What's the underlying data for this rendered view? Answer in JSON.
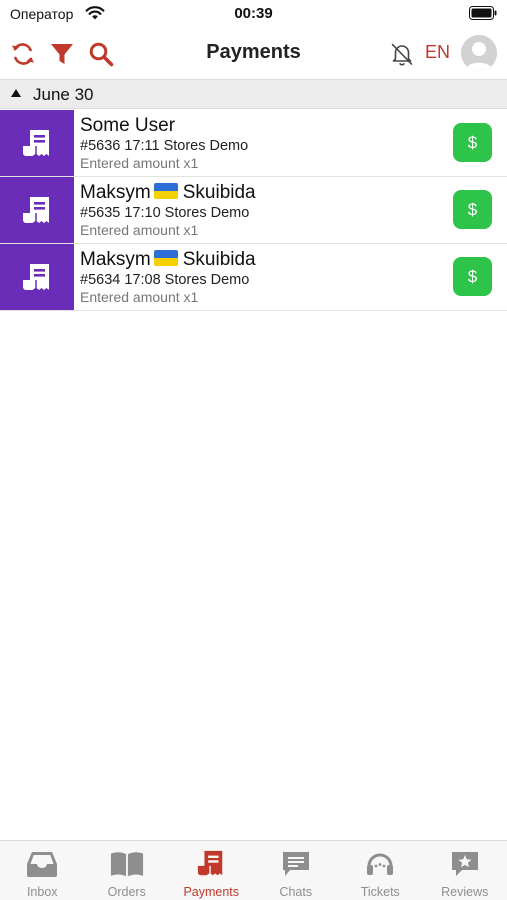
{
  "status_bar": {
    "carrier": "Оператор",
    "time": "00:39"
  },
  "header": {
    "title": "Payments",
    "language": "EN",
    "icons": [
      "refresh-icon",
      "filter-icon",
      "search-icon",
      "notifications-off-icon",
      "avatar"
    ]
  },
  "section": {
    "date": "June 30",
    "collapsed_indicator": "triangle-up"
  },
  "payments": [
    {
      "name": "Some User",
      "has_flag": false,
      "meta": "#5636 17:11 Stores Demo",
      "sub": "Entered amount x1",
      "action_label": "$"
    },
    {
      "name": "Maksym",
      "name_suffix": "Skuibida",
      "has_flag": true,
      "meta": "#5635 17:10 Stores Demo",
      "sub": "Entered amount x1",
      "action_label": "$"
    },
    {
      "name": "Maksym",
      "name_suffix": "Skuibida",
      "has_flag": true,
      "meta": "#5634 17:08 Stores Demo",
      "sub": "Entered amount x1",
      "action_label": "$"
    }
  ],
  "tabs": [
    {
      "label": "Inbox",
      "icon": "inbox-icon",
      "active": false
    },
    {
      "label": "Orders",
      "icon": "book-icon",
      "active": false
    },
    {
      "label": "Payments",
      "icon": "receipt-icon",
      "active": true
    },
    {
      "label": "Chats",
      "icon": "chat-icon",
      "active": false
    },
    {
      "label": "Tickets",
      "icon": "headset-icon",
      "active": false
    },
    {
      "label": "Reviews",
      "icon": "review-icon",
      "active": false
    }
  ],
  "colors": {
    "accent": "#c0392b",
    "tile": "#6a2db8",
    "pay_button": "#2ec44a",
    "tab_inactive": "#8e8e8e"
  }
}
